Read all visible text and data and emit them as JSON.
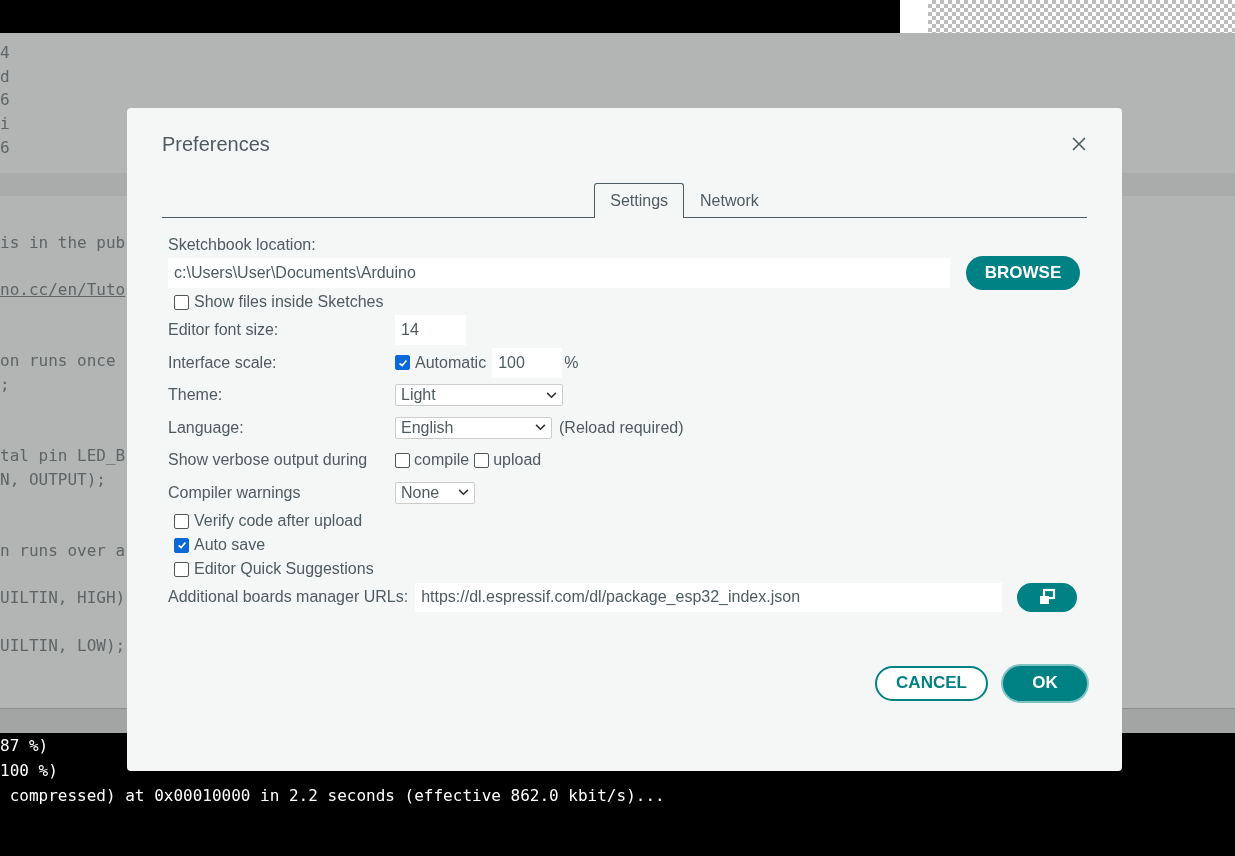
{
  "editor": {
    "blocks": [
      [
        "4",
        "d",
        "6",
        "i",
        "6"
      ],
      [
        "is in the pub"
      ],
      [
        "no.cc/en/Tuto"
      ],
      [
        "on runs once",
        ";"
      ],
      [
        "tal pin LED_B",
        "N, OUTPUT);"
      ],
      [
        "n runs over a"
      ],
      [
        "UILTIN, HIGH)"
      ],
      [
        "UILTIN, LOW);"
      ]
    ]
  },
  "console": {
    "lines": [
      "87 %)",
      "100 %)",
      " compressed) at 0x00010000 in 2.2 seconds (effective 862.0 kbit/s)..."
    ]
  },
  "dialog": {
    "title": "Preferences",
    "tabs": [
      {
        "label": "Settings",
        "selected": true
      },
      {
        "label": "Network",
        "selected": false
      }
    ],
    "settings": [
      {
        "kind": "path",
        "label": "Sketchbook location:",
        "value": "c:\\Users\\User\\Documents\\Arduino",
        "button": "BROWSE"
      },
      {
        "kind": "checkbox",
        "label": "Show files inside Sketches",
        "checked": false
      },
      {
        "kind": "number",
        "label": "Editor font size:",
        "value": "14"
      },
      {
        "kind": "scale",
        "label": "Interface scale:",
        "option": "Automatic",
        "checked": true,
        "value": "100",
        "unit": "%"
      },
      {
        "kind": "select",
        "label": "Theme:",
        "value": "Light"
      },
      {
        "kind": "select",
        "label": "Language:",
        "value": "English",
        "note": "(Reload required)"
      },
      {
        "kind": "checks",
        "label": "Show verbose output during",
        "options": [
          {
            "label": "compile",
            "checked": false
          },
          {
            "label": "upload",
            "checked": false
          }
        ]
      },
      {
        "kind": "select",
        "label": "Compiler warnings",
        "value": "None"
      },
      {
        "kind": "checkbox",
        "label": "Verify code after upload",
        "checked": false
      },
      {
        "kind": "checkbox",
        "label": "Auto save",
        "checked": true
      },
      {
        "kind": "checkbox",
        "label": "Editor Quick Suggestions",
        "checked": false
      },
      {
        "kind": "url",
        "label": "Additional boards manager URLs:",
        "value": "https://dl.espressif.com/dl/package_esp32_index.json"
      }
    ],
    "buttons": [
      {
        "label": "CANCEL",
        "kind": "secondary"
      },
      {
        "label": "OK",
        "kind": "primary"
      }
    ]
  }
}
